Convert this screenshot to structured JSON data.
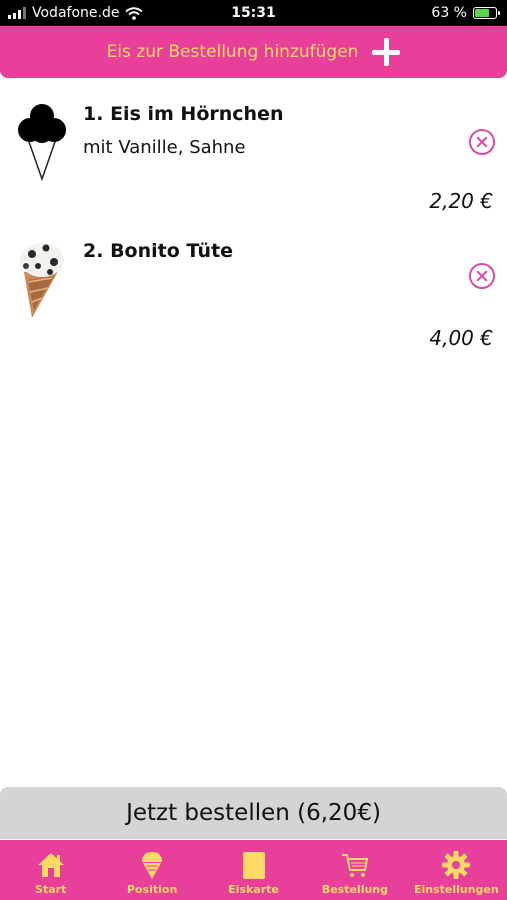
{
  "status_bar": {
    "carrier": "Vodafone.de",
    "time": "15:31",
    "battery": "63 %"
  },
  "header": {
    "add_label": "Eis zur Bestellung hinzufügen"
  },
  "order_items": [
    {
      "number": "1.",
      "name": "Eis im Hörnchen",
      "details": "mit Vanille, Sahne",
      "price": "2,20 €"
    },
    {
      "number": "2.",
      "name": "Bonito Tüte",
      "details": "",
      "price": "4,00 €"
    }
  ],
  "order_button": {
    "label": "Jetzt bestellen (6,20€)"
  },
  "tabbar": {
    "tabs": [
      {
        "label": "Start",
        "icon": "home-icon"
      },
      {
        "label": "Position",
        "icon": "ice-cream-cone-icon"
      },
      {
        "label": "Eiskarte",
        "icon": "menu-card-icon"
      },
      {
        "label": "Bestellung",
        "icon": "shopping-cart-icon"
      },
      {
        "label": "Einstellungen",
        "icon": "gear-icon"
      }
    ]
  },
  "colors": {
    "accent_pink": "#e8409a",
    "label_yellow": "#ffd966",
    "remove_icon": "#d94aa8"
  }
}
